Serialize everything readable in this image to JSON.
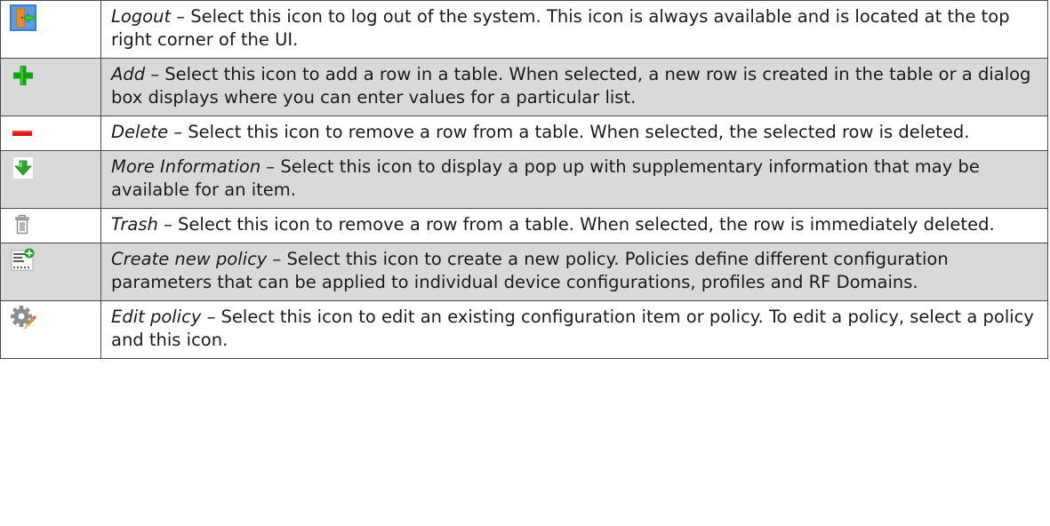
{
  "rows": [
    {
      "icon": "logout-icon",
      "term": "Logout",
      "text": " – Select this icon to log out of the system. This icon is always available and is located at the top right corner of the UI.",
      "shaded": false
    },
    {
      "icon": "add-icon",
      "term": "Add",
      "text": " – Select this icon to add a row in a table. When selected, a new row is created in the table or a dialog box displays where you can enter values for a particular list.",
      "shaded": true
    },
    {
      "icon": "delete-icon",
      "term": "Delete",
      "text": " – Select this icon to remove a row from a table. When selected, the selected row is deleted.",
      "shaded": false
    },
    {
      "icon": "more-information-icon",
      "term": "More Information",
      "text": " – Select this icon to display a pop up with supplementary information that may be available for an item.",
      "shaded": true
    },
    {
      "icon": "trash-icon",
      "term": "Trash",
      "text": " – Select this icon to remove a row from a table. When selected, the row is immediately deleted.",
      "shaded": false
    },
    {
      "icon": "create-new-policy-icon",
      "term": "Create new policy",
      "text": " – Select this icon to create a new policy. Policies define different configuration parameters that can be applied to individual device configurations, profiles and RF Domains.",
      "shaded": true
    },
    {
      "icon": "edit-policy-icon",
      "term": "Edit policy",
      "text": " – Select this icon to edit an existing configuration item or policy. To edit a policy, select a policy and this icon.",
      "shaded": false
    }
  ]
}
